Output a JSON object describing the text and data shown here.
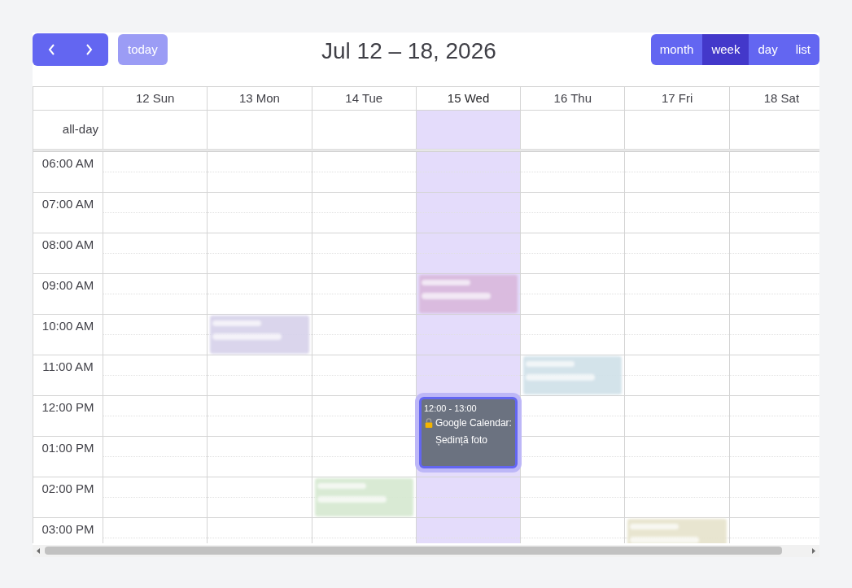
{
  "toolbar": {
    "today": {
      "label": "today",
      "disabled": true
    },
    "title": "Jul 12 – 18, 2026",
    "views": [
      {
        "label": "month",
        "selected": false
      },
      {
        "label": "week",
        "selected": true
      },
      {
        "label": "day",
        "selected": false
      },
      {
        "label": "list",
        "selected": false
      }
    ]
  },
  "all_day_label": "all-day",
  "days": [
    {
      "label": "12 Sun",
      "today": false
    },
    {
      "label": "13 Mon",
      "today": false
    },
    {
      "label": "14 Tue",
      "today": false
    },
    {
      "label": "15 Wed",
      "today": true
    },
    {
      "label": "16 Thu",
      "today": false
    },
    {
      "label": "17 Fri",
      "today": false
    },
    {
      "label": "18 Sat",
      "today": false
    }
  ],
  "hours": [
    "06:00 AM",
    "07:00 AM",
    "08:00 AM",
    "09:00 AM",
    "10:00 AM",
    "11:00 AM",
    "12:00 PM",
    "01:00 PM",
    "02:00 PM",
    "03:00 PM"
  ],
  "events": [
    {
      "color": "#d9b8dc",
      "blurred": true,
      "selected": false,
      "locked": false
    },
    {
      "color": "#d6d1ea",
      "blurred": true,
      "selected": false,
      "locked": false
    },
    {
      "color": "#cfe0e8",
      "blurred": true,
      "selected": false,
      "locked": false
    },
    {
      "time": "12:00 - 13:00",
      "title": "Google Calendar: Ședință foto",
      "color": "#6b7280",
      "blurred": false,
      "selected": true,
      "locked": true
    },
    {
      "color": "#d5e8d0",
      "blurred": true,
      "selected": false,
      "locked": false
    },
    {
      "color": "#e6e3cc",
      "blurred": true,
      "selected": false,
      "locked": false
    }
  ]
}
